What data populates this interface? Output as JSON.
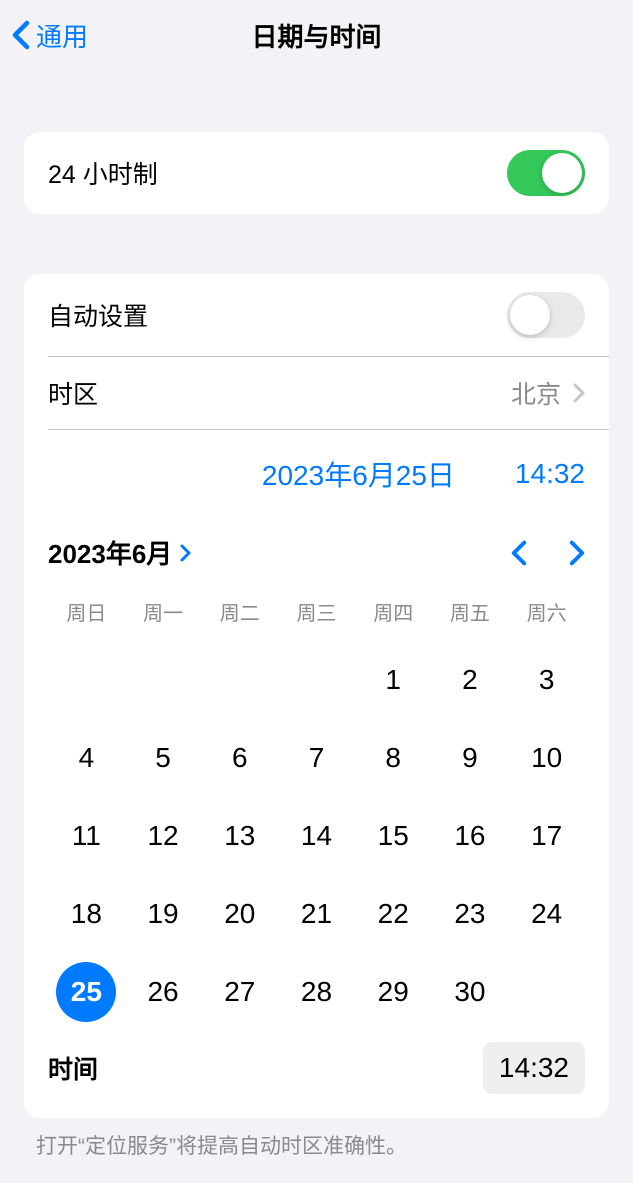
{
  "nav": {
    "back_label": "通用",
    "title": "日期与时间"
  },
  "twenty_four_hour": {
    "label": "24 小时制",
    "enabled": true
  },
  "auto_set": {
    "label": "自动设置",
    "enabled": false
  },
  "timezone": {
    "label": "时区",
    "value": "北京"
  },
  "selected": {
    "date_display": "2023年6月25日",
    "time_display": "14:32"
  },
  "calendar": {
    "month_label": "2023年6月",
    "weekdays": [
      "周日",
      "周一",
      "周二",
      "周三",
      "周四",
      "周五",
      "周六"
    ],
    "leading_blanks": 4,
    "days_in_month": 30,
    "selected_day": 25
  },
  "time_row": {
    "label": "时间",
    "value": "14:32"
  },
  "footer": {
    "note": "打开“定位服务”将提高自动时区准确性。"
  }
}
